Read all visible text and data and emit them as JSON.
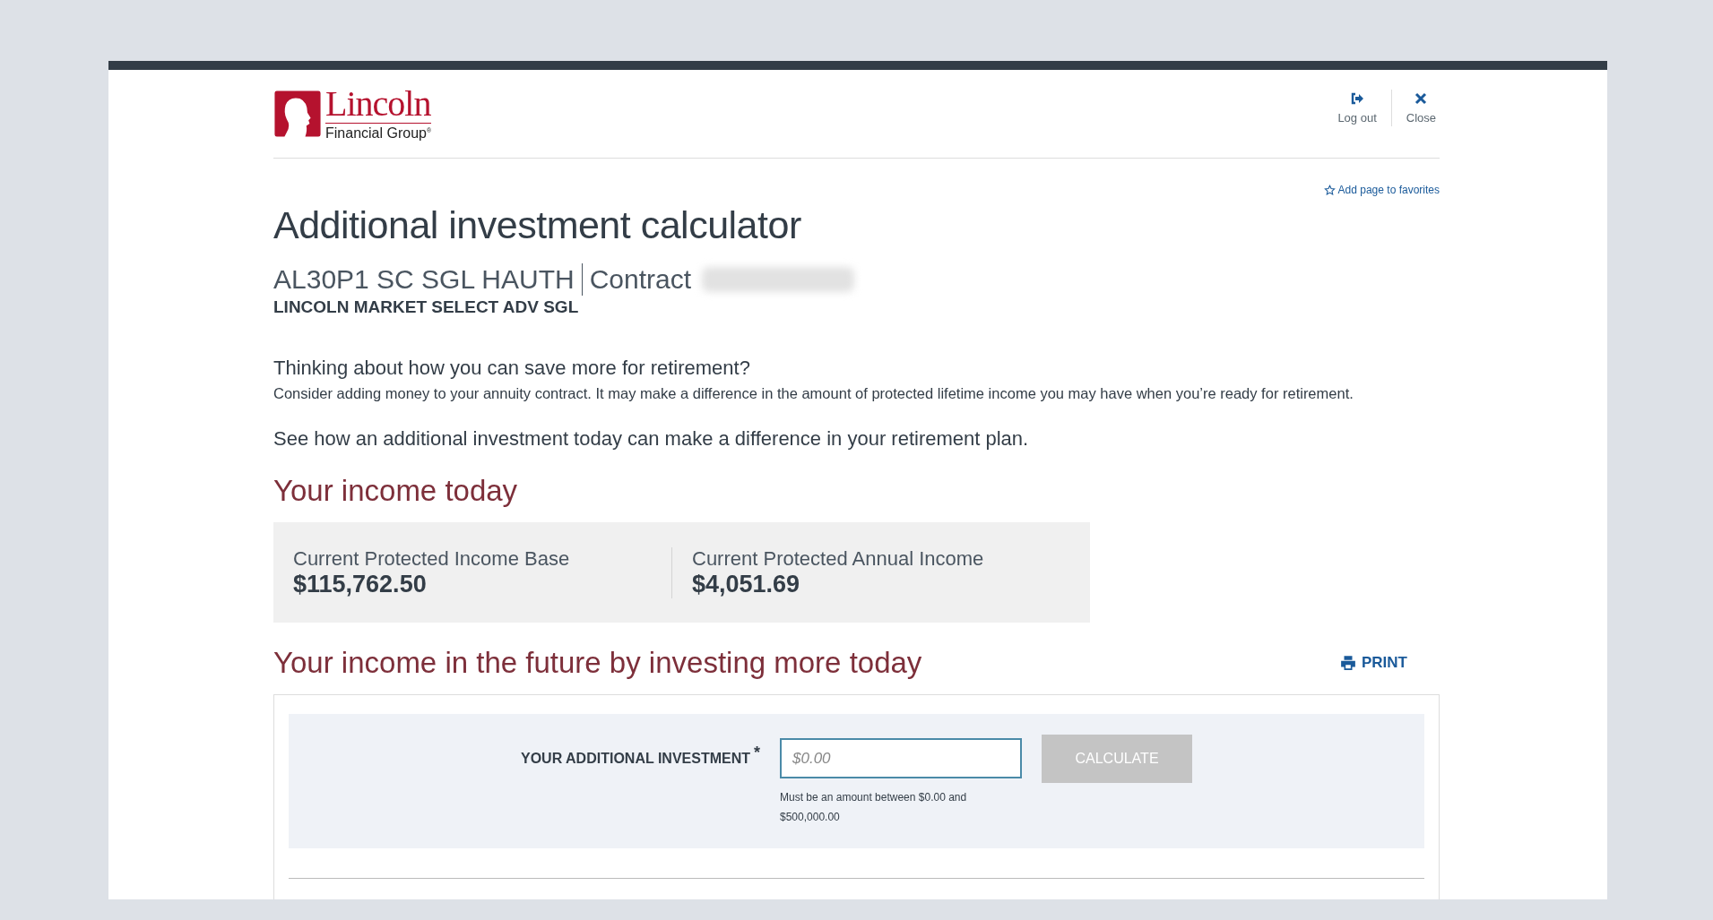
{
  "logo": {
    "name": "Lincoln",
    "subtitle": "Financial Group",
    "mark": "®"
  },
  "header_actions": [
    {
      "kind": "logout",
      "label": "Log out"
    },
    {
      "kind": "close",
      "label": "Close"
    }
  ],
  "favorites_link": "Add page to favorites",
  "title": "Additional investment calculator",
  "contract": {
    "name": "AL30P1 SC SGL HAUTH",
    "label": "Contract",
    "number_redacted": true,
    "product": "LINCOLN MARKET SELECT ADV SGL"
  },
  "intro": {
    "question": "Thinking about how you can save more for retirement?",
    "text": "Consider adding money to your annuity contract. It may make a difference in the amount of protected lifetime income you may have when you’re ready for retirement.",
    "lead": "See how an additional investment today can make a difference in your retirement plan."
  },
  "income_today": {
    "heading": "Your income today",
    "metrics": [
      {
        "label": "Current Protected Income Base",
        "value": "$115,762.50"
      },
      {
        "label": "Current Protected Annual Income",
        "value": "$4,051.69"
      }
    ]
  },
  "future": {
    "heading": "Your income in the future by investing more today",
    "print": "PRINT",
    "field_label": "YOUR ADDITIONAL INVESTMENT",
    "required_mark": "*",
    "placeholder": "$0.00",
    "hint": "Must be an amount between $0.00 and $500,000.00",
    "button": {
      "label": "CALCULATE",
      "disabled": true
    }
  }
}
